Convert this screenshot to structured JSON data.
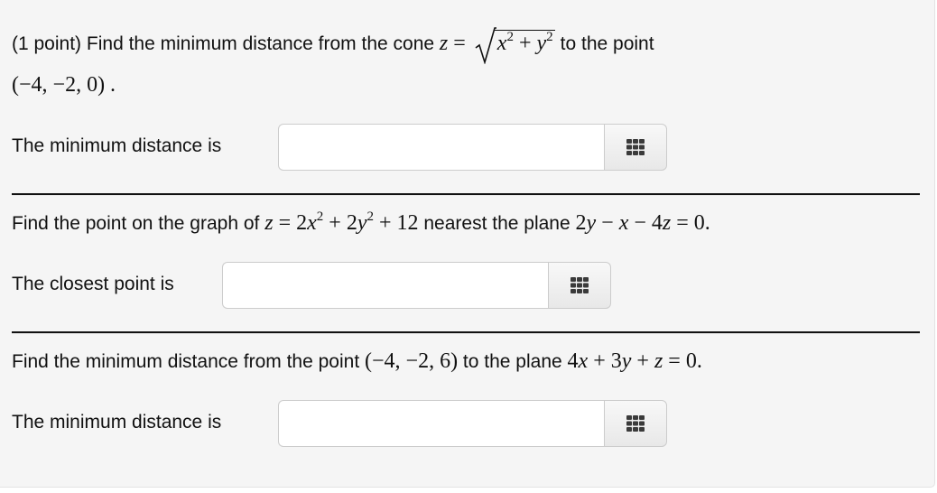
{
  "problem": {
    "points_label": "(1 point)",
    "parts": [
      {
        "prompt_prefix": "Find the minimum distance from the cone",
        "equation_lhs": "z",
        "equation_rel": "=",
        "sqrt_terms": {
          "a": "x",
          "a_exp": "2",
          "op": "+",
          "b": "y",
          "b_exp": "2"
        },
        "prompt_suffix": "to the point",
        "point": "(−4, −2, 0) .",
        "answer_label": "The minimum distance is",
        "answer_value": "",
        "keypad_icon": "grid-3x3-icon"
      },
      {
        "prompt_prefix": "Find the point on the graph of",
        "equation": {
          "lhs": "z",
          "rel": "=",
          "t1_coef": "2",
          "t1_var": "x",
          "t1_exp": "2",
          "op1": "+",
          "t2_coef": "2",
          "t2_var": "y",
          "t2_exp": "2",
          "op2": "+",
          "const": "12"
        },
        "prompt_middle": "nearest the plane",
        "plane": {
          "t1": "2",
          "t1_var": "y",
          "op1": "−",
          "t2_var": "x",
          "op2": "−",
          "t3": "4",
          "t3_var": "z",
          "rel": "=",
          "rhs": "0."
        },
        "answer_label": "The closest point is",
        "answer_value": "",
        "keypad_icon": "grid-3x3-icon"
      },
      {
        "prompt_prefix": "Find the minimum distance from the point",
        "point": "(−4, −2, 6)",
        "prompt_middle": "to the plane",
        "plane": {
          "t1": "4",
          "t1_var": "x",
          "op1": "+",
          "t2": "3",
          "t2_var": "y",
          "op2": "+",
          "t3_var": "z",
          "rel": "=",
          "rhs": "0."
        },
        "answer_label": "The minimum distance is",
        "answer_value": "",
        "keypad_icon": "grid-3x3-icon"
      }
    ]
  }
}
